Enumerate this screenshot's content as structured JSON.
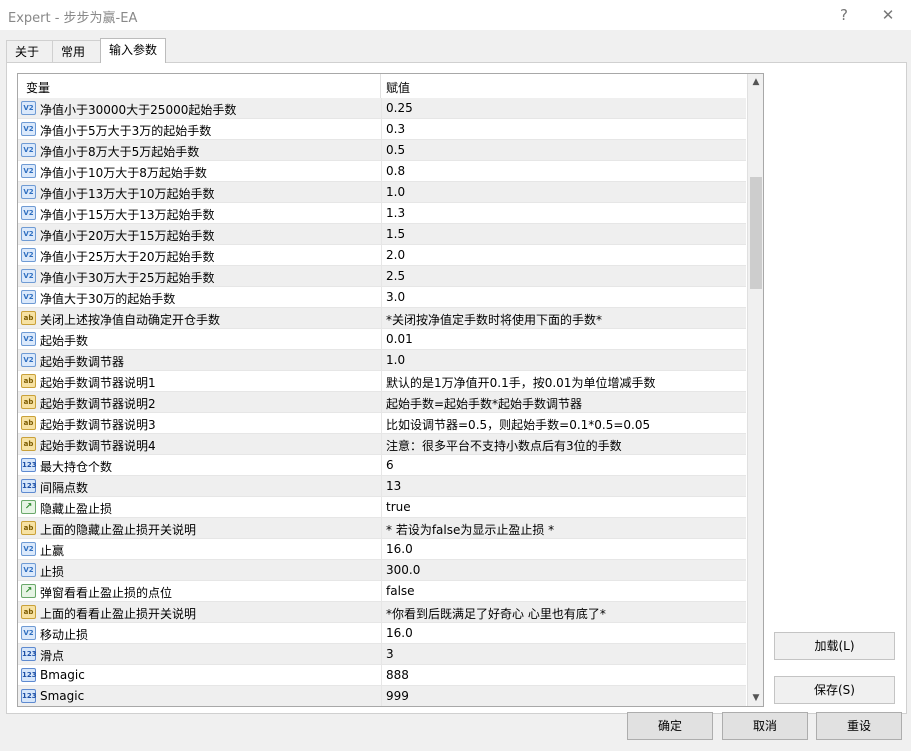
{
  "window": {
    "title": "Expert - 步步为赢-EA",
    "help": "?",
    "close": "✕"
  },
  "tabs": [
    {
      "label": "关于"
    },
    {
      "label": "常用"
    },
    {
      "label": "输入参数"
    }
  ],
  "grid": {
    "col_variable": "变量",
    "col_value": "赋值",
    "rows": [
      {
        "icon": "v2",
        "name": "净值小于30000大于25000起始手数",
        "value": "0.25"
      },
      {
        "icon": "v2",
        "name": "净值小于5万大于3万的起始手数",
        "value": "0.3"
      },
      {
        "icon": "v2",
        "name": "净值小于8万大于5万起始手数",
        "value": "0.5"
      },
      {
        "icon": "v2",
        "name": "净值小于10万大于8万起始手数",
        "value": "0.8"
      },
      {
        "icon": "v2",
        "name": "净值小于13万大于10万起始手数",
        "value": "1.0"
      },
      {
        "icon": "v2",
        "name": "净值小于15万大于13万起始手数",
        "value": "1.3"
      },
      {
        "icon": "v2",
        "name": "净值小于20万大于15万起始手数",
        "value": "1.5"
      },
      {
        "icon": "v2",
        "name": "净值小于25万大于20万起始手数",
        "value": "2.0"
      },
      {
        "icon": "v2",
        "name": "净值小于30万大于25万起始手数",
        "value": "2.5"
      },
      {
        "icon": "v2",
        "name": "净值大于30万的起始手数",
        "value": "3.0"
      },
      {
        "icon": "ab",
        "name": "关闭上述按净值自动确定开仓手数",
        "value": "*关闭按净值定手数时将使用下面的手数*"
      },
      {
        "icon": "v2",
        "name": "起始手数",
        "value": "0.01"
      },
      {
        "icon": "v2",
        "name": "起始手数调节器",
        "value": "1.0"
      },
      {
        "icon": "ab",
        "name": "起始手数调节器说明1",
        "value": "默认的是1万净值开0.1手，按0.01为单位增减手数"
      },
      {
        "icon": "ab",
        "name": "起始手数调节器说明2",
        "value": "起始手数=起始手数*起始手数调节器"
      },
      {
        "icon": "ab",
        "name": "起始手数调节器说明3",
        "value": "比如设调节器=0.5，则起始手数=0.1*0.5=0.05"
      },
      {
        "icon": "ab",
        "name": "起始手数调节器说明4",
        "value": "注意：很多平台不支持小数点后有3位的手数"
      },
      {
        "icon": "n123",
        "name": "最大持仓个数",
        "value": "6"
      },
      {
        "icon": "n123",
        "name": "间隔点数",
        "value": "13"
      },
      {
        "icon": "bool",
        "name": "隐藏止盈止损",
        "value": "true"
      },
      {
        "icon": "ab",
        "name": "上面的隐藏止盈止损开关说明",
        "value": "* 若设为false为显示止盈止损 *"
      },
      {
        "icon": "v2",
        "name": "止赢",
        "value": "16.0"
      },
      {
        "icon": "v2",
        "name": "止损",
        "value": "300.0"
      },
      {
        "icon": "bool",
        "name": "弹窗看看止盈止损的点位",
        "value": "false"
      },
      {
        "icon": "ab",
        "name": "上面的看看止盈止损开关说明",
        "value": "*你看到后既满足了好奇心 心里也有底了*"
      },
      {
        "icon": "v2",
        "name": "移动止损",
        "value": "16.0"
      },
      {
        "icon": "n123",
        "name": "滑点",
        "value": "3"
      },
      {
        "icon": "n123",
        "name": "Bmagic",
        "value": "888"
      },
      {
        "icon": "n123",
        "name": "Smagic",
        "value": "999"
      }
    ]
  },
  "icon_glyphs": {
    "v2": "V2",
    "ab": "ab",
    "n123": "123",
    "bool": "↗"
  },
  "side_buttons": {
    "load": "加载(L)",
    "save": "保存(S)"
  },
  "footer_buttons": {
    "ok": "确定",
    "cancel": "取消",
    "reset": "重设"
  }
}
